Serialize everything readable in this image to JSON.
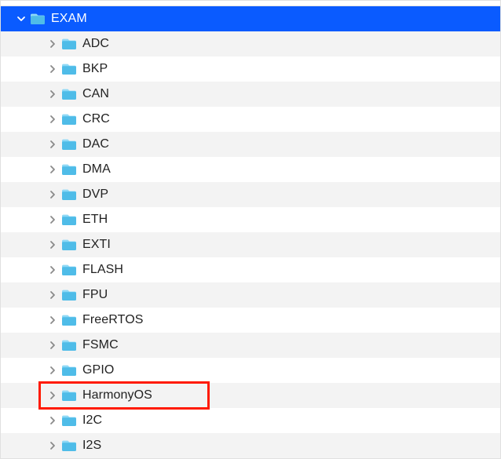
{
  "colors": {
    "selection": "#0a5bff",
    "alt_row": "#f3f3f3",
    "highlight_border": "#ff1a00",
    "folder_light": "#8fd9f6",
    "folder_dark": "#4fbce8"
  },
  "root": {
    "name": "EXAM",
    "expanded": true,
    "selected": true,
    "children": [
      {
        "name": "ADC",
        "highlighted": false
      },
      {
        "name": "BKP",
        "highlighted": false
      },
      {
        "name": "CAN",
        "highlighted": false
      },
      {
        "name": "CRC",
        "highlighted": false
      },
      {
        "name": "DAC",
        "highlighted": false
      },
      {
        "name": "DMA",
        "highlighted": false
      },
      {
        "name": "DVP",
        "highlighted": false
      },
      {
        "name": "ETH",
        "highlighted": false
      },
      {
        "name": "EXTI",
        "highlighted": false
      },
      {
        "name": "FLASH",
        "highlighted": false
      },
      {
        "name": "FPU",
        "highlighted": false
      },
      {
        "name": "FreeRTOS",
        "highlighted": false
      },
      {
        "name": "FSMC",
        "highlighted": false
      },
      {
        "name": "GPIO",
        "highlighted": false
      },
      {
        "name": "HarmonyOS",
        "highlighted": true
      },
      {
        "name": "I2C",
        "highlighted": false
      },
      {
        "name": "I2S",
        "highlighted": false
      }
    ]
  }
}
